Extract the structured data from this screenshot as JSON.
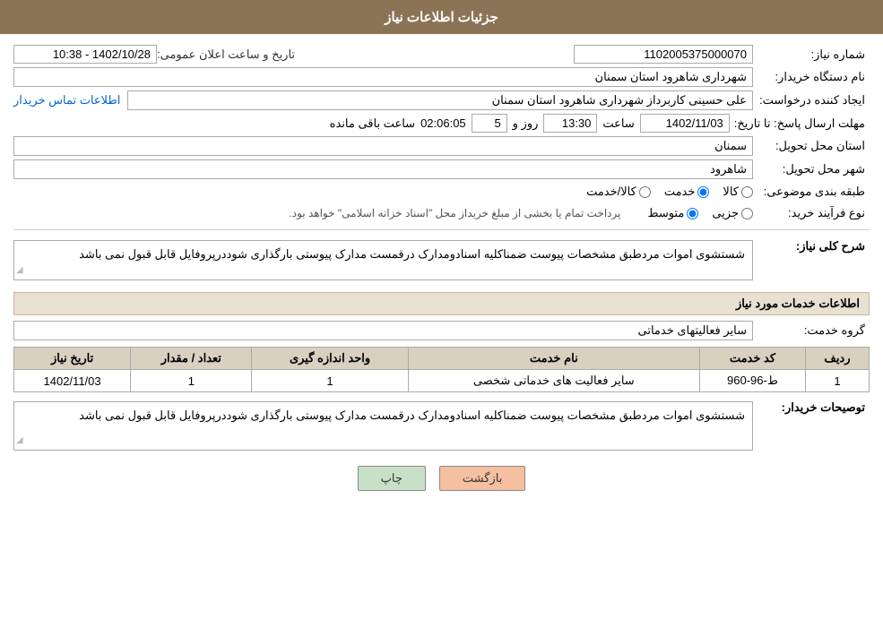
{
  "header": {
    "title": "جزئیات اطلاعات نیاز"
  },
  "fields": {
    "need_number_label": "شماره نیاز:",
    "need_number_value": "1102005375000070",
    "buyer_org_label": "نام دستگاه خریدار:",
    "buyer_org_value": "شهرداری شاهرود استان سمنان",
    "requester_label": "ایجاد کننده درخواست:",
    "requester_value": "علی حسینی کاربرداز شهرداری شاهرود استان سمنان",
    "requester_link": "اطلاعات تماس خریدار",
    "announce_label": "تاریخ و ساعت اعلان عمومی:",
    "announce_value": "1402/10/28 - 10:38",
    "response_deadline_label": "مهلت ارسال پاسخ: تا تاریخ:",
    "response_date": "1402/11/03",
    "response_time_label": "ساعت",
    "response_time": "13:30",
    "response_days_label": "روز و",
    "response_days": "5",
    "response_remaining_label": "ساعت باقی مانده",
    "response_remaining": "02:06:05",
    "province_label": "استان محل تحویل:",
    "province_value": "سمنان",
    "city_label": "شهر محل تحویل:",
    "city_value": "شاهرود",
    "category_label": "طبقه بندی موضوعی:",
    "category_kala": "کالا",
    "category_khedmat": "خدمت",
    "category_kala_khedmat": "کالا/خدمت",
    "category_selected": "خدمت",
    "purchase_type_label": "نوع فرآیند خرید:",
    "purchase_jozei": "جزیی",
    "purchase_motavaset": "متوسط",
    "purchase_notice": "پرداخت تمام یا بخشی از مبلغ خریداز محل \"اسناد خزانه اسلامی\" خواهد بود.",
    "need_description_label": "شرح کلی نیاز:",
    "need_description": "شستشوی اموات مردطبق مشخصات پیوست ضمناکلیه اسنادومدارک درقمست مدارک پیوستی بارگذاری شوددرپروفایل قابل قبول نمی باشد",
    "services_section_label": "اطلاعات خدمات مورد نیاز",
    "service_group_label": "گروه خدمت:",
    "service_group_value": "سایر فعالیتهای خدماتی",
    "table": {
      "headers": [
        "ردیف",
        "کد خدمت",
        "نام خدمت",
        "واحد اندازه گیری",
        "تعداد / مقدار",
        "تاریخ نیاز"
      ],
      "rows": [
        {
          "row": "1",
          "code": "ط-96-960",
          "name": "سایر فعالیت های خدماتی شخصی",
          "unit": "1",
          "quantity": "1",
          "date": "1402/11/03"
        }
      ]
    },
    "buyer_notes_label": "توصیحات خریدار:",
    "buyer_notes": "شستشوی اموات مردطبق مشخصات پیوست ضمناکلیه اسنادومدارک درقمست مدارک پیوستی بارگذاری شوددرپروفایل قابل قبول نمی باشد"
  },
  "buttons": {
    "print_label": "چاپ",
    "back_label": "بازگشت"
  }
}
